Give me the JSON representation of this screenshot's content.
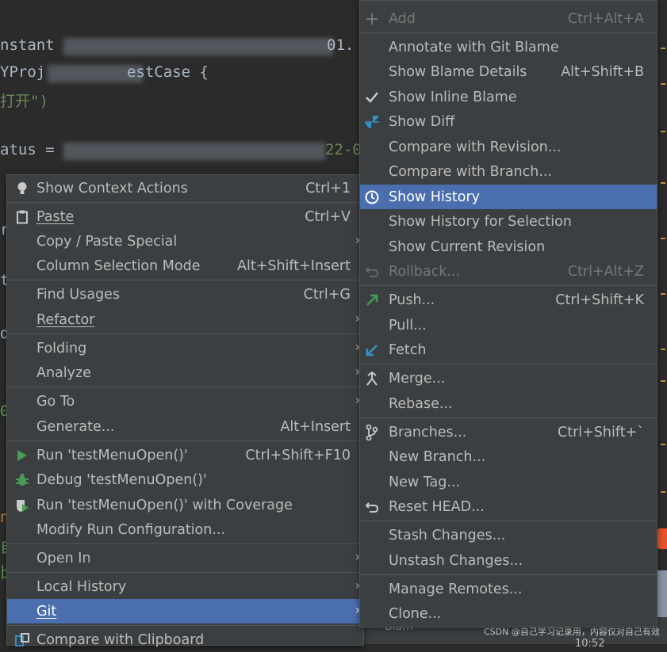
{
  "editor": {
    "lines": [
      {
        "text": "nstant "
      },
      {
        "text": "YProj"
      },
      {
        "text": "打开\")"
      },
      {
        "text": "atus = "
      },
      {
        "text": "r"
      },
      {
        "text": "t"
      },
      {
        "text": "d"
      },
      {
        "text": "0"
      },
      {
        "text": "n"
      },
      {
        "text": "自"
      },
      {
        "text": "比"
      }
    ],
    "snippets": {
      "suffix1": "01.",
      "suffix2": "estCase {",
      "suffix3": "22-0"
    }
  },
  "watermark": "CSDN @自己学习记录用，内容仅对自己有效",
  "status_time": "10:52",
  "status_text": "Blam",
  "context_menu": {
    "items": [
      {
        "label": "Show Context Actions",
        "shortcut": "Ctrl+1",
        "icon": "bulb-icon"
      },
      {
        "label": "Paste",
        "shortcut": "Ctrl+V",
        "icon": "clipboard-icon"
      },
      {
        "label": "Copy / Paste Special",
        "shortcut": "",
        "icon": ""
      },
      {
        "label": "Column Selection Mode",
        "shortcut": "Alt+Shift+Insert",
        "icon": ""
      },
      {
        "label": "Find Usages",
        "shortcut": "Ctrl+G",
        "icon": ""
      },
      {
        "label": "Refactor",
        "shortcut": "",
        "icon": ""
      },
      {
        "label": "Folding",
        "shortcut": "",
        "icon": ""
      },
      {
        "label": "Analyze",
        "shortcut": "",
        "icon": ""
      },
      {
        "label": "Go To",
        "shortcut": "",
        "icon": ""
      },
      {
        "label": "Generate...",
        "shortcut": "Alt+Insert",
        "icon": ""
      },
      {
        "label": "Run 'testMenuOpen()'",
        "shortcut": "Ctrl+Shift+F10",
        "icon": "run-icon"
      },
      {
        "label": "Debug 'testMenuOpen()'",
        "shortcut": "",
        "icon": "debug-icon"
      },
      {
        "label": "Run 'testMenuOpen()' with Coverage",
        "shortcut": "",
        "icon": "coverage-icon"
      },
      {
        "label": "Modify Run Configuration...",
        "shortcut": "",
        "icon": ""
      },
      {
        "label": "Open In",
        "shortcut": "",
        "icon": ""
      },
      {
        "label": "Local History",
        "shortcut": "",
        "icon": ""
      },
      {
        "label": "Git",
        "shortcut": "",
        "icon": ""
      },
      {
        "label": "Compare with Clipboard",
        "shortcut": "",
        "icon": "compare-icon"
      }
    ]
  },
  "git_menu": {
    "items": [
      {
        "label": "Add",
        "shortcut": "Ctrl+Alt+A",
        "icon": "plus-icon"
      },
      {
        "label": "Annotate with Git Blame",
        "shortcut": "",
        "icon": ""
      },
      {
        "label": "Show Blame Details",
        "shortcut": "Alt+Shift+B",
        "icon": ""
      },
      {
        "label": "Show Inline Blame",
        "shortcut": "",
        "icon": "check-icon"
      },
      {
        "label": "Show Diff",
        "shortcut": "",
        "icon": "diff-icon"
      },
      {
        "label": "Compare with Revision...",
        "shortcut": "",
        "icon": ""
      },
      {
        "label": "Compare with Branch...",
        "shortcut": "",
        "icon": ""
      },
      {
        "label": "Show History",
        "shortcut": "",
        "icon": "clock-icon"
      },
      {
        "label": "Show History for Selection",
        "shortcut": "",
        "icon": ""
      },
      {
        "label": "Show Current Revision",
        "shortcut": "",
        "icon": ""
      },
      {
        "label": "Rollback...",
        "shortcut": "Ctrl+Alt+Z",
        "icon": "undo-icon"
      },
      {
        "label": "Push...",
        "shortcut": "Ctrl+Shift+K",
        "icon": "push-arrow-icon"
      },
      {
        "label": "Pull...",
        "shortcut": "",
        "icon": ""
      },
      {
        "label": "Fetch",
        "shortcut": "",
        "icon": "fetch-arrow-icon"
      },
      {
        "label": "Merge...",
        "shortcut": "",
        "icon": "merge-icon"
      },
      {
        "label": "Rebase...",
        "shortcut": "",
        "icon": ""
      },
      {
        "label": "Branches...",
        "shortcut": "Ctrl+Shift+`",
        "icon": "branch-icon"
      },
      {
        "label": "New Branch...",
        "shortcut": "",
        "icon": ""
      },
      {
        "label": "New Tag...",
        "shortcut": "",
        "icon": ""
      },
      {
        "label": "Reset HEAD...",
        "shortcut": "",
        "icon": "reset-icon"
      },
      {
        "label": "Stash Changes...",
        "shortcut": "",
        "icon": ""
      },
      {
        "label": "Unstash Changes...",
        "shortcut": "",
        "icon": ""
      },
      {
        "label": "Manage Remotes...",
        "shortcut": "",
        "icon": ""
      },
      {
        "label": "Clone...",
        "shortcut": "",
        "icon": ""
      }
    ]
  },
  "colors": {
    "menu_bg": "#3c3f41",
    "selection": "#4b6eaf",
    "editor_bg": "#2b2b2b",
    "run_green": "#499c54",
    "info_blue": "#3592c4"
  }
}
